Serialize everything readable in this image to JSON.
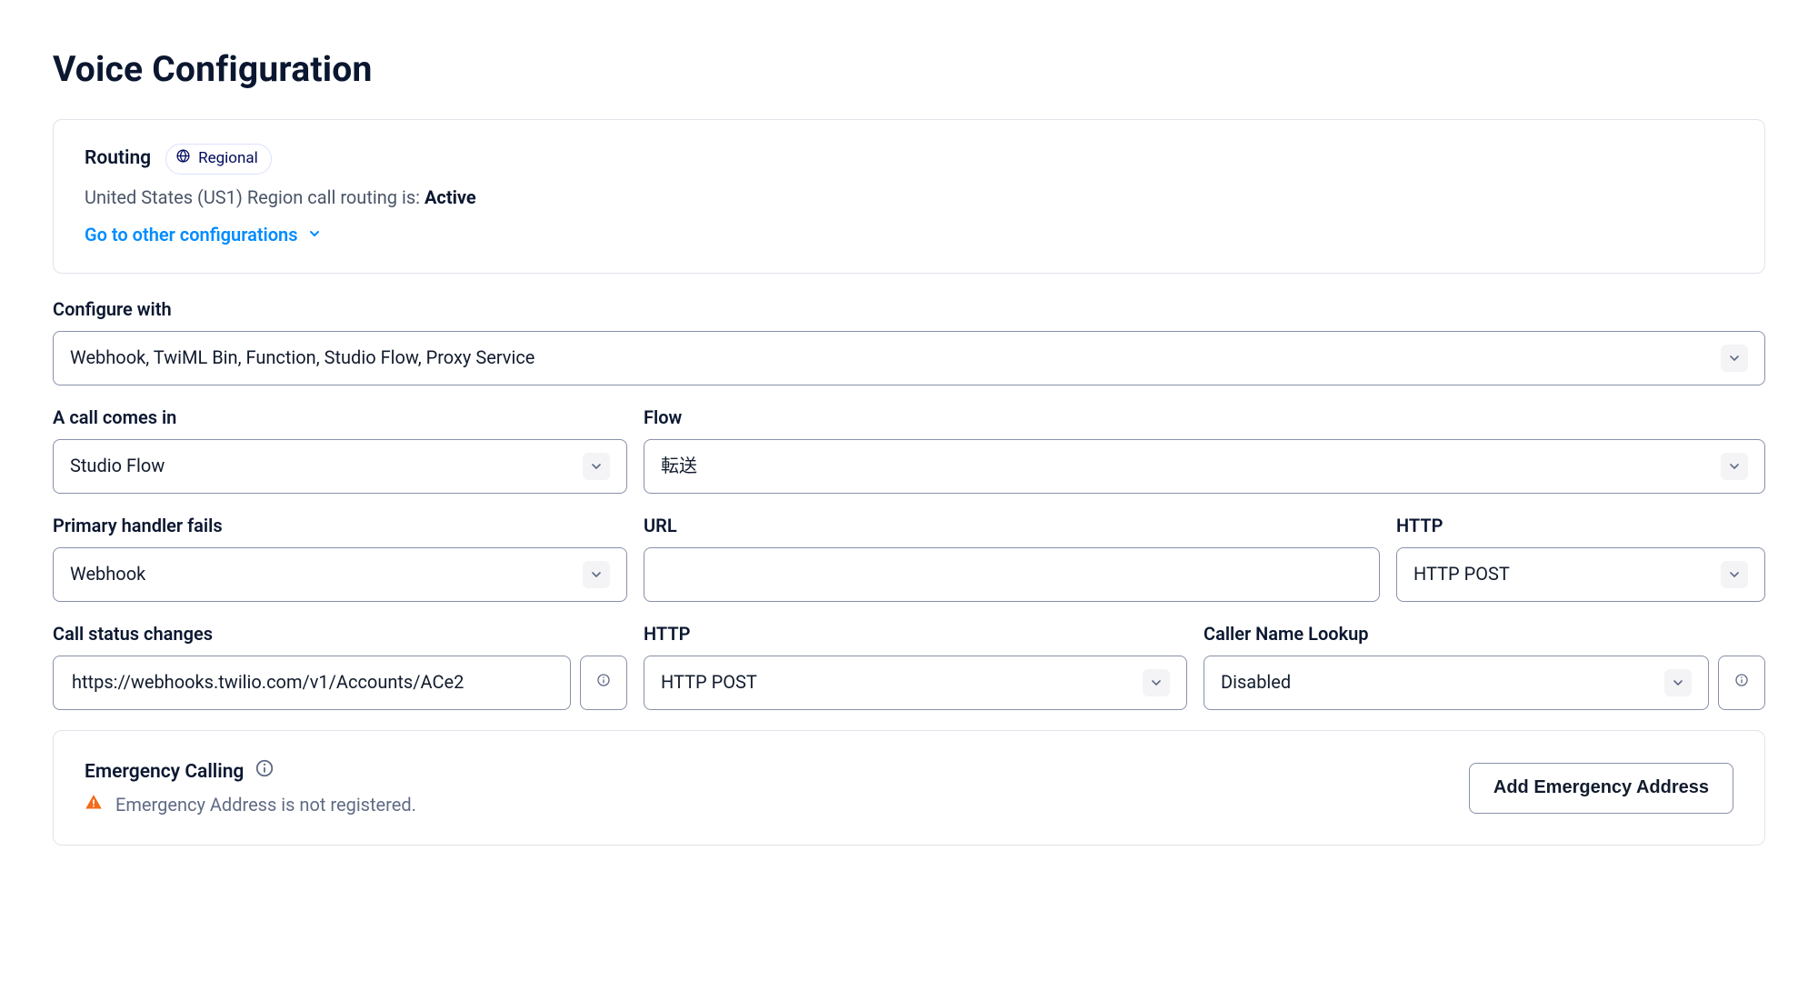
{
  "page": {
    "title": "Voice Configuration"
  },
  "routing": {
    "heading": "Routing",
    "chip_label": "Regional",
    "status_prefix": "United States (US1) Region call routing is: ",
    "status_value": "Active",
    "link_label": "Go to other configurations"
  },
  "configure_with": {
    "label": "Configure with",
    "value": "Webhook, TwiML Bin, Function, Studio Flow, Proxy Service"
  },
  "call_comes_in": {
    "label": "A call comes in",
    "value": "Studio Flow"
  },
  "flow": {
    "label": "Flow",
    "value": "転送"
  },
  "primary_fail": {
    "label": "Primary handler fails",
    "value": "Webhook"
  },
  "url": {
    "label": "URL",
    "value": ""
  },
  "http_small": {
    "label": "HTTP",
    "value": "HTTP POST"
  },
  "call_status": {
    "label": "Call status changes",
    "value": "https://webhooks.twilio.com/v1/Accounts/ACe2"
  },
  "http_wide": {
    "label": "HTTP",
    "value": "HTTP POST"
  },
  "cname_lookup": {
    "label": "Caller Name Lookup",
    "value": "Disabled"
  },
  "emergency": {
    "heading": "Emergency Calling",
    "message": "Emergency Address is not registered.",
    "button": "Add Emergency Address"
  }
}
